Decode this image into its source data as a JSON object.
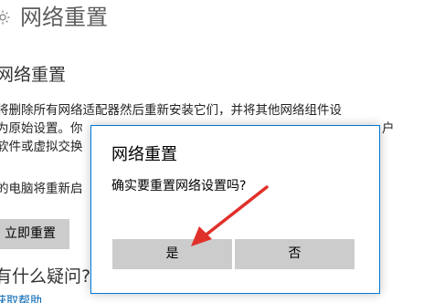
{
  "settings_page": {
    "title": "网络重置",
    "section_title": "网络重置",
    "description_line1": "将删除所有网络适配器然后重新安装它们，并将其他网络组件设",
    "description_line2": "为原始设置。你",
    "description_line2_tail": "户",
    "description_line3": "软件或虚拟交换",
    "description_line4": "的电脑将重新启",
    "reset_now_button": "立即重置",
    "questions_heading": "有什么疑问?",
    "help_link": "获取帮助"
  },
  "dialog": {
    "title": "网络重置",
    "message": "确实要重置网络设置吗?",
    "yes_button": "是",
    "no_button": "否"
  },
  "colors": {
    "accent": "#0078d7",
    "button_bg": "#cccccc",
    "annotation": "#e0302a",
    "link": "#0063b1"
  },
  "icons": {
    "header": "gear-icon",
    "annotation": "red-arrow"
  }
}
